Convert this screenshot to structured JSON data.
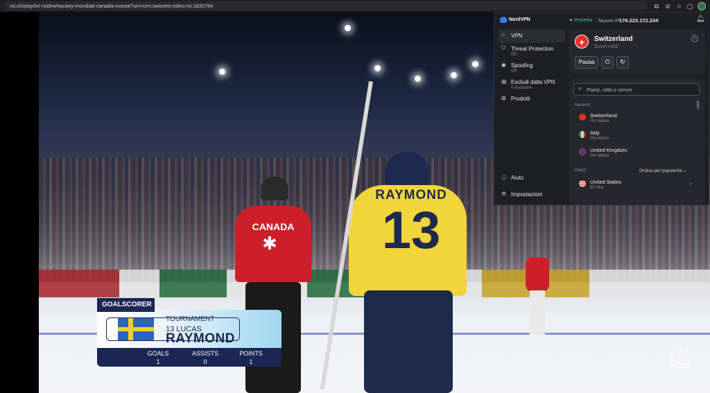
{
  "browser": {
    "url": "rsi.ch/play/tv/-/video/hockey-mondiali-canada-svezia?urn=urn:swisstxt:video:rsi:1830784",
    "icons": [
      "translate-icon",
      "eye-off-icon",
      "star-icon",
      "extension-icon"
    ]
  },
  "video": {
    "yellow_player_name": "RAYMOND",
    "yellow_player_number": "13",
    "red_player_text": "CANADA",
    "scorebug": {
      "tab": "GOALSCORER",
      "tournament": "TOURNAMENT",
      "number_first": "13 LUCAS",
      "last_name": "RAYMOND",
      "flag": "Sweden",
      "stats": [
        {
          "label": "GOALS",
          "value": "1"
        },
        {
          "label": "ASSISTS",
          "value": "0"
        },
        {
          "label": "POINTS",
          "value": "1"
        }
      ]
    }
  },
  "vpn": {
    "brand": "NordVPN",
    "status": "Protetta",
    "ip_label": "Nuovo IP:",
    "ip": "176.223.172.234",
    "nav": [
      {
        "label": "VPN",
        "sub": "",
        "icon": "home-icon"
      },
      {
        "label": "Threat Protection",
        "sub": "Off",
        "icon": "shield-icon"
      },
      {
        "label": "Spoofing",
        "sub": "Off",
        "icon": "eye-icon"
      },
      {
        "label": "Escludi dalla VPN",
        "sub": "0 esclusa/e",
        "icon": "split-icon"
      },
      {
        "label": "Prodotti",
        "sub": "",
        "icon": "grid-icon"
      }
    ],
    "nav_bottom": [
      {
        "label": "Aiuto",
        "icon": "help-icon"
      },
      {
        "label": "Impostazioni",
        "icon": "gear-icon"
      }
    ],
    "connection": {
      "country": "Switzerland",
      "server": "Zurich #353",
      "pause_label": "Pausa"
    },
    "search_placeholder": "Paesi, città o server",
    "recent_label": "Recenti",
    "recent": [
      {
        "name": "Switzerland",
        "sub": "Più veloce",
        "color": "#e3312b"
      },
      {
        "name": "Italy",
        "sub": "Più veloce",
        "color": "#2f9e44"
      },
      {
        "name": "United Kingdom",
        "sub": "Più veloce",
        "color": "#2b4a9e"
      }
    ],
    "countries_label": "Paesi",
    "sort_label": "Ordina per popolarità",
    "countries": [
      {
        "name": "United States",
        "sub": "55 città",
        "color": "#3b5ab8"
      }
    ]
  }
}
